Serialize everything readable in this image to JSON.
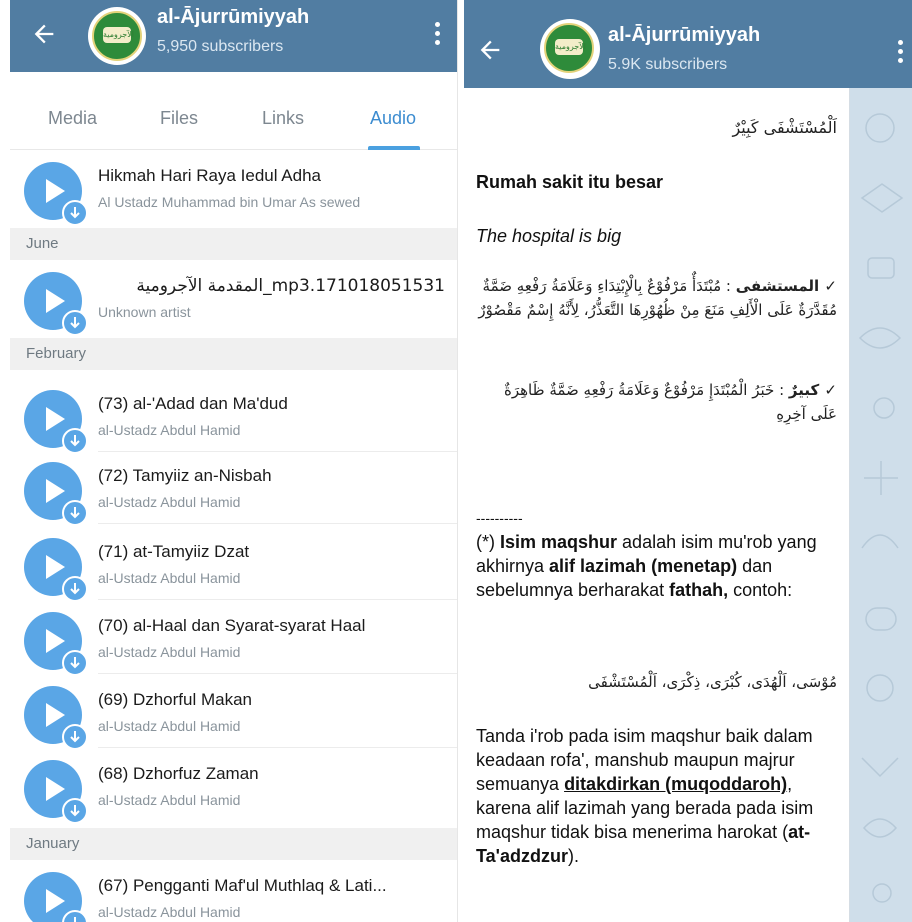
{
  "left": {
    "channel_title": "al-Ājurrūmiyyah",
    "subscribers": "5,950 subscribers",
    "tabs": [
      "Media",
      "Files",
      "Links",
      "Audio"
    ],
    "active_tab": "Audio",
    "items": [
      {
        "title": "Hikmah Hari Raya Iedul Adha",
        "artist": "Al Ustadz Muhammad bin Umar As sewed"
      },
      {
        "title": "mp3.171018051531_المقدمة الآجرومية",
        "artist": "Unknown artist"
      },
      {
        "title": "(73) al-'Adad dan Ma'dud",
        "artist": "al-Ustadz Abdul Hamid"
      },
      {
        "title": "(72) Tamyiiz an-Nisbah",
        "artist": "al-Ustadz Abdul Hamid"
      },
      {
        "title": "(71) at-Tamyiiz Dzat",
        "artist": "al-Ustadz Abdul Hamid"
      },
      {
        "title": "(70) al-Haal dan Syarat-syarat Haal",
        "artist": "al-Ustadz Abdul Hamid"
      },
      {
        "title": "(69) Dzhorful Makan",
        "artist": "al-Ustadz Abdul Hamid"
      },
      {
        "title": "(68) Dzhorfuz Zaman",
        "artist": "al-Ustadz Abdul Hamid"
      },
      {
        "title": "(67) Pengganti Maf'ul Muthlaq & Lati...",
        "artist": "al-Ustadz Abdul Hamid"
      }
    ],
    "sections": [
      "June",
      "February",
      "January"
    ]
  },
  "right": {
    "channel_title": "al-Ājurrūmiyyah",
    "subscribers": "5.9K subscribers",
    "message": {
      "arabic_example": "اَلْمُسْتَشْفَى كَبِيْرٌ",
      "translation_id": "Rumah sakit itu besar",
      "translation_en": "The hospital is big",
      "analysis1_word": "✓ المستشفى",
      "analysis1_text": ": مُبْتَدَأٌ مَرْفُوْعٌ بِالْإِبْتِدَاءِ وَعَلَامَةُ رَفْعِهِ ضَمَّةٌ مُقَدَّرَةٌ عَلَى الْأَلِفِ مَنَعَ مِنْ ظُهُوْرِهَا التَّعَذُّرُ، لِأَنَّهُ إِسْمٌ مَقْصُوْرٌ",
      "analysis2_word": "✓ كبيرٌ",
      "analysis2_text": ": خَبَرُ الْمُبْتَدَإِ مَرْفُوْعٌ وَعَلَامَةُ رَفْعِهِ ضَمَّةٌ ظَاهِرَةٌ عَلَى آخِرِهِ",
      "divider": "----------",
      "note_pre": "(*) ",
      "note_b1": "Isim maqshur",
      "note_t1": " adalah isim mu'rob yang akhirnya ",
      "note_b2": "alif lazimah (menetap)",
      "note_t2": " dan sebelumnya berharakat ",
      "note_b3": "fathah,",
      "note_t3": " contoh:",
      "examples_arabic": "مُوْسَى، اَلْهُدَى، كُبْرَى، ذِكْرَى، اَلْمُسْتَشْفَى",
      "tanda_t1": "Tanda i'rob pada isim maqshur baik dalam keadaan rofa', manshub maupun majrur semuanya ",
      "tanda_u": "ditakdirkan (muqoddaroh)",
      "tanda_t2": ", karena alif lazimah yang berada pada isim maqshur tidak bisa menerima harokat (",
      "tanda_b": "at-Ta'adzdzur",
      "tanda_t3": ")."
    }
  },
  "colors": {
    "header": "#517da2",
    "accent": "#3c8cd0",
    "play": "#5aa6e6",
    "chat_bg": "#c9d8e6"
  }
}
